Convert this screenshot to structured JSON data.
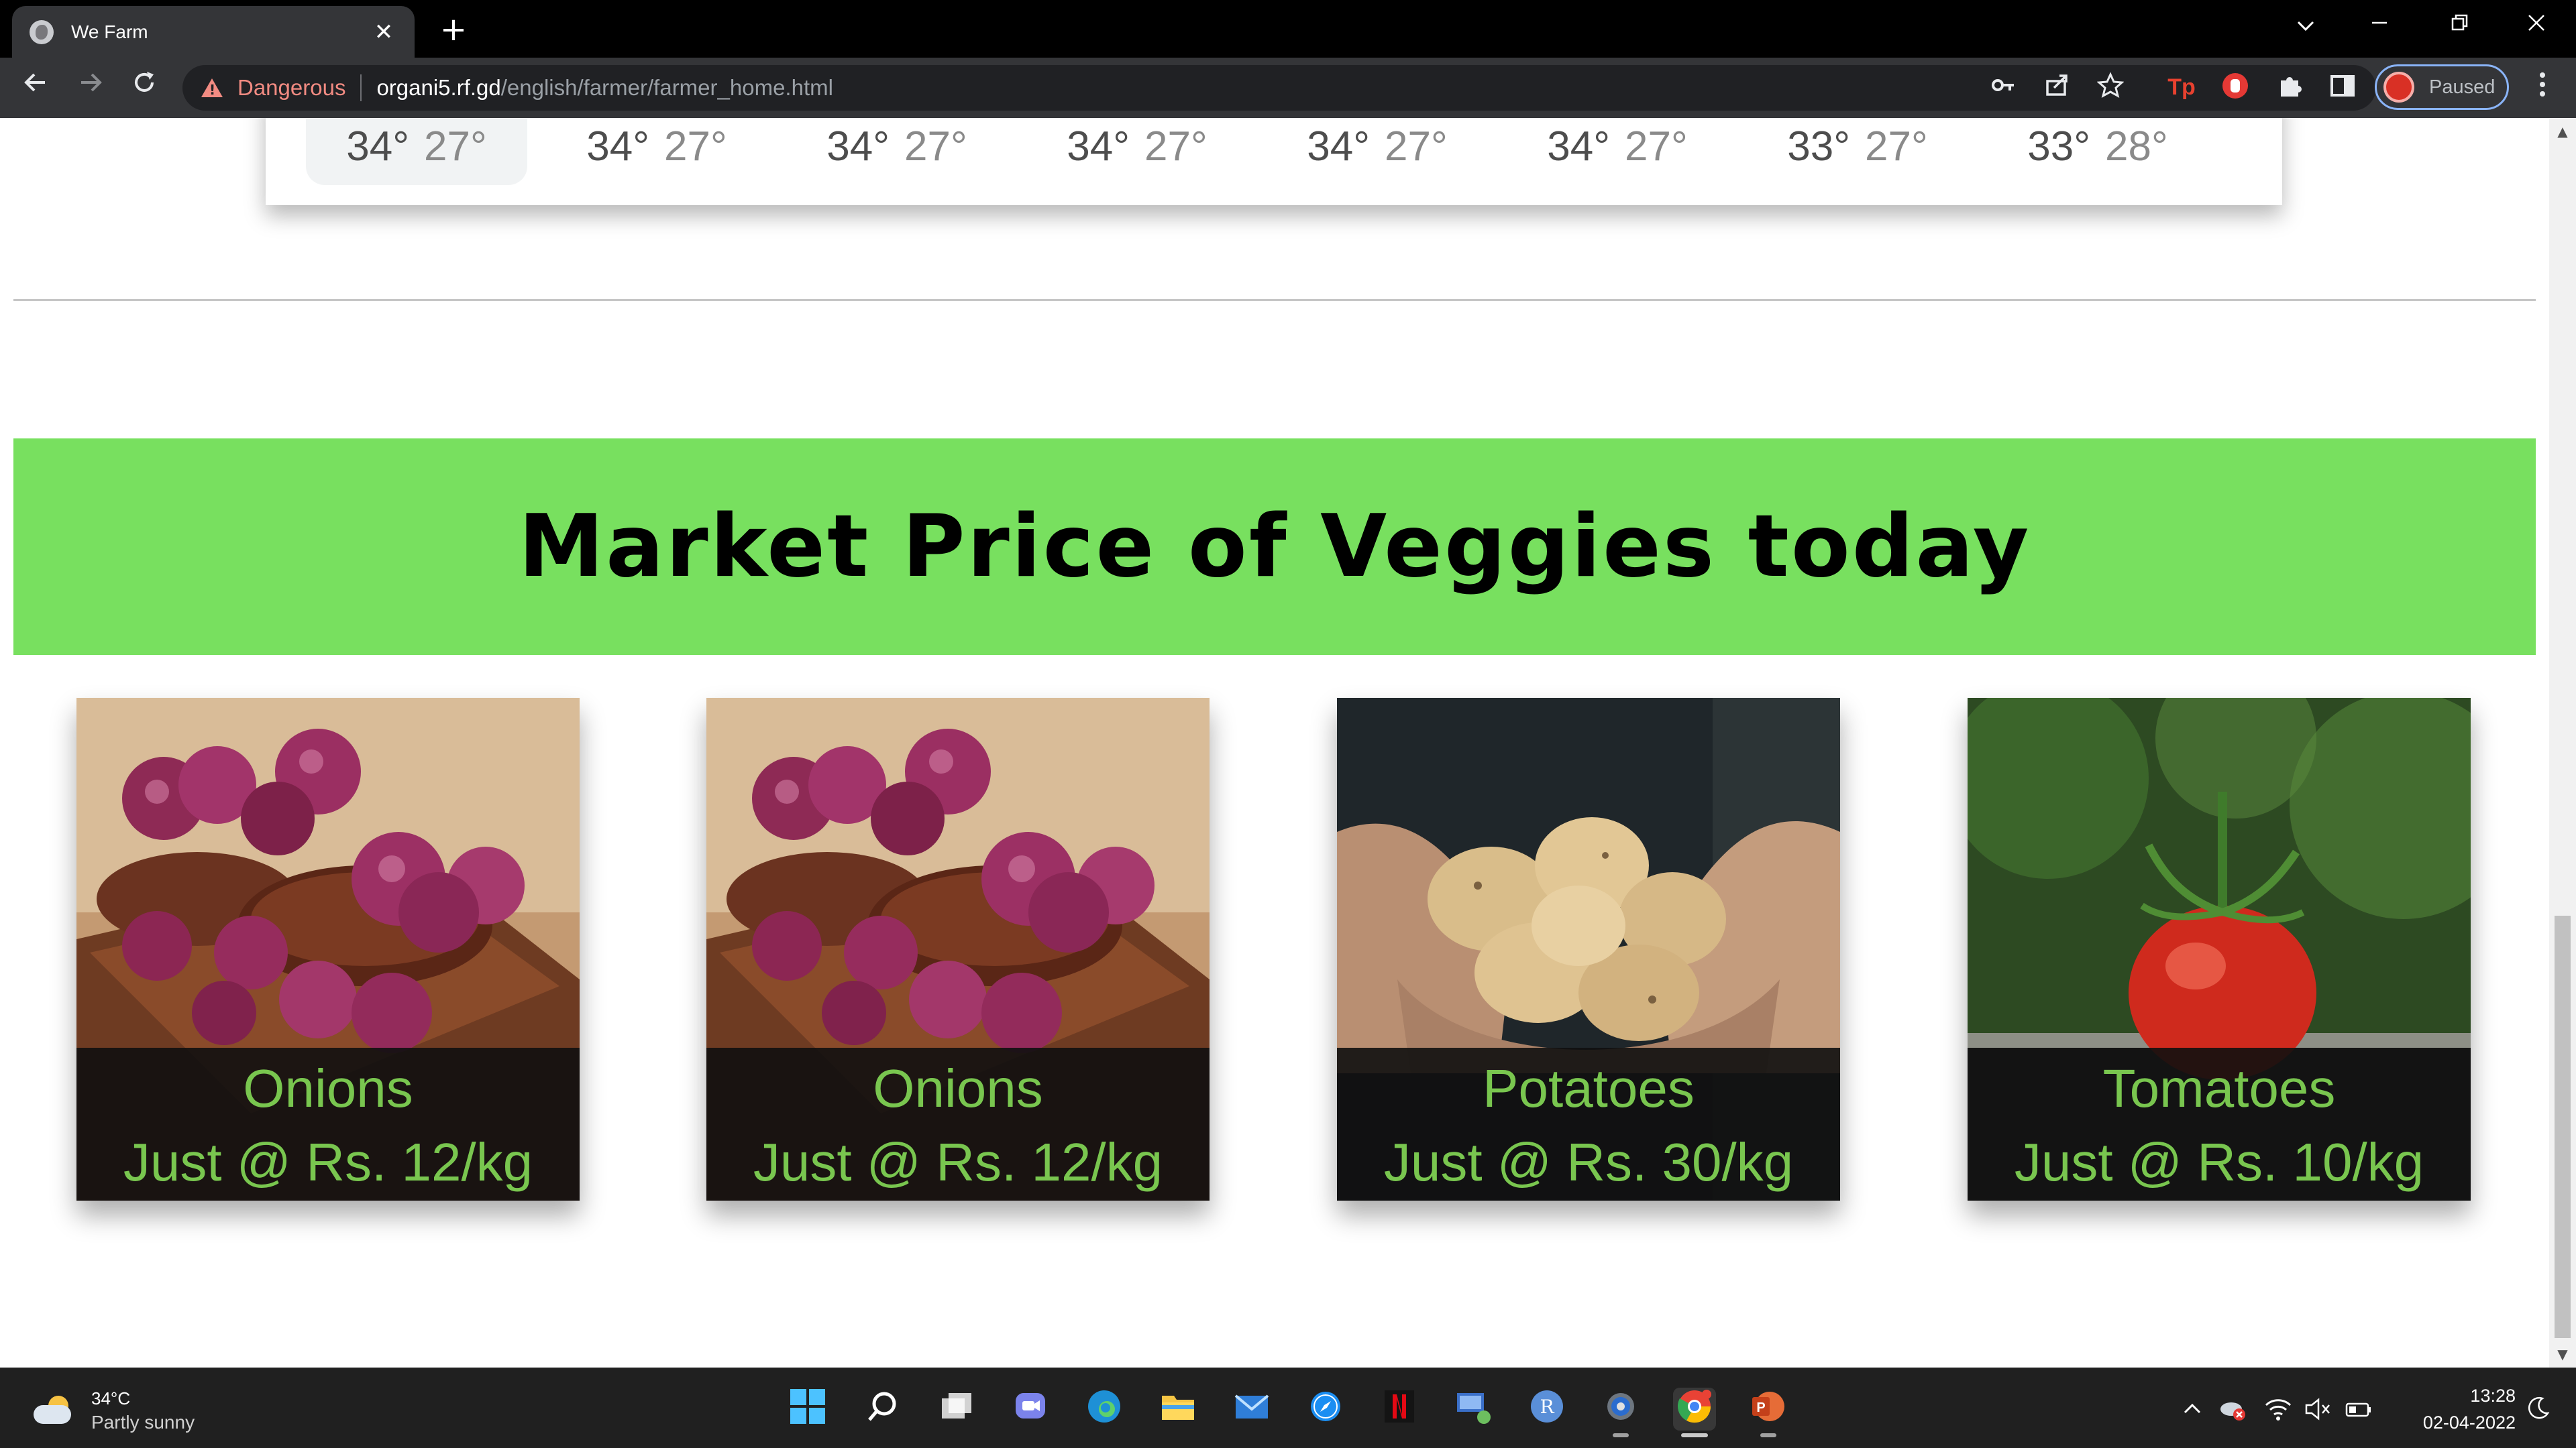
{
  "browser": {
    "tab_title": "We Farm",
    "close_glyph": "✕",
    "new_tab_glyph": "+",
    "security_label": "Dangerous",
    "url_host": "organi5.rf.gd",
    "url_path": "/english/farmer/farmer_home.html",
    "profile_status": "Paused",
    "danger_color": "#f28b82"
  },
  "weather": {
    "days": [
      {
        "hi": "34°",
        "lo": "27°"
      },
      {
        "hi": "34°",
        "lo": "27°"
      },
      {
        "hi": "34°",
        "lo": "27°"
      },
      {
        "hi": "34°",
        "lo": "27°"
      },
      {
        "hi": "34°",
        "lo": "27°"
      },
      {
        "hi": "34°",
        "lo": "27°"
      },
      {
        "hi": "33°",
        "lo": "27°"
      },
      {
        "hi": "33°",
        "lo": "28°"
      }
    ]
  },
  "market": {
    "title": "Market Price of Veggies today",
    "banner_color": "#78e05f",
    "caption_color": "#79c64f",
    "items": [
      {
        "name": "Onions",
        "price": "Just @ Rs. 12/kg",
        "image": "onions-photo"
      },
      {
        "name": "Onions",
        "price": "Just @ Rs. 12/kg",
        "image": "onions-photo"
      },
      {
        "name": "Potatoes",
        "price": "Just @ Rs. 30/kg",
        "image": "potatoes-photo"
      },
      {
        "name": "Tomatoes",
        "price": "Just @ Rs. 10/kg",
        "image": "tomato-photo"
      }
    ]
  },
  "taskbar": {
    "weather_temp": "34°C",
    "weather_desc": "Partly sunny",
    "time": "13:28",
    "date": "02-04-2022"
  }
}
